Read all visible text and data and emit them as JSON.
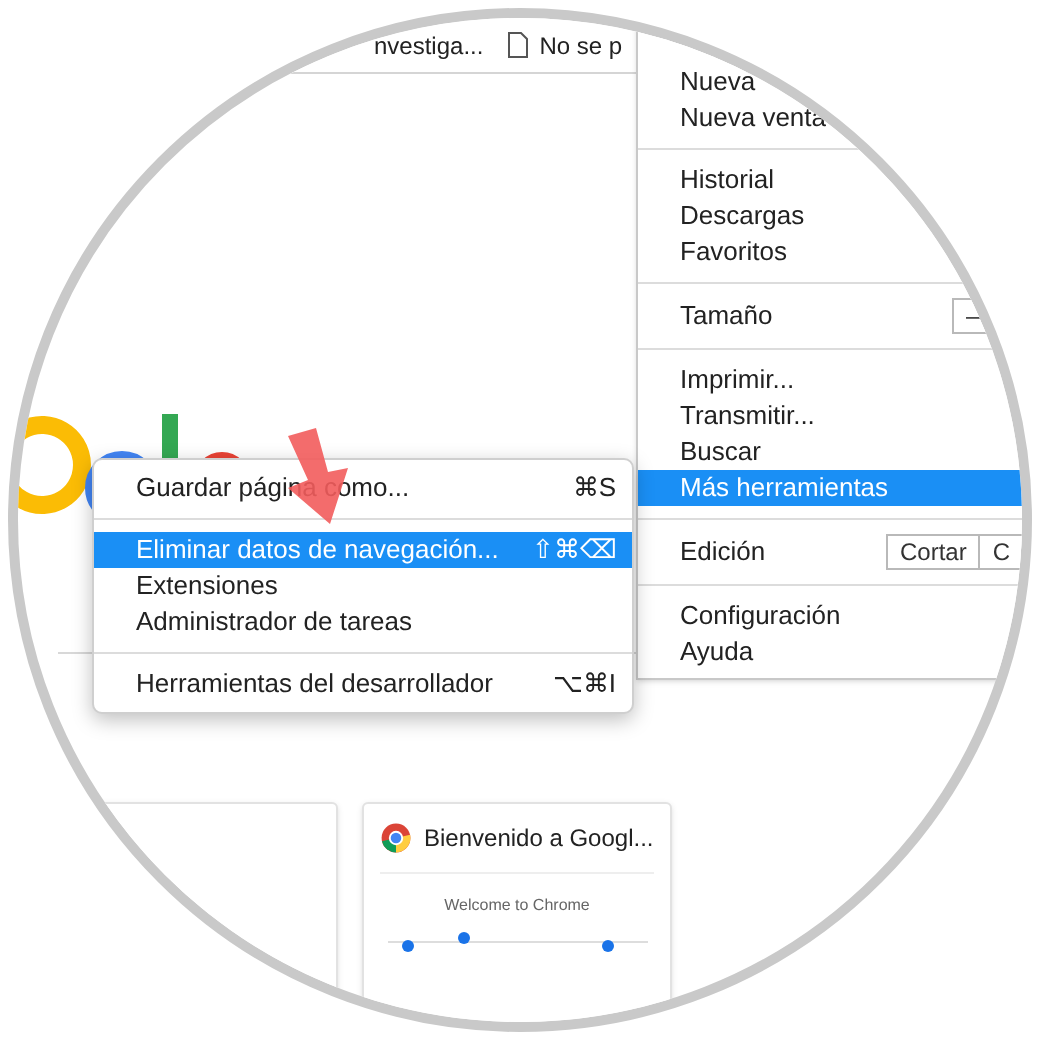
{
  "bookmarks": [
    {
      "label": "nvestiga...",
      "kind": "plain"
    },
    {
      "label": "No se p",
      "kind": "page"
    }
  ],
  "main_menu": [
    {
      "kind": "items",
      "items": [
        {
          "label": "Nueva",
          "selected": false
        },
        {
          "label": "Nueva venta",
          "selected": false
        }
      ]
    },
    {
      "kind": "items",
      "items": [
        {
          "label": "Historial",
          "selected": false
        },
        {
          "label": "Descargas",
          "selected": false
        },
        {
          "label": "Favoritos",
          "selected": false
        }
      ]
    },
    {
      "kind": "zoom",
      "label": "Tamaño",
      "buttons": [
        "—"
      ]
    },
    {
      "kind": "items",
      "items": [
        {
          "label": "Imprimir...",
          "selected": false
        },
        {
          "label": "Transmitir...",
          "selected": false
        },
        {
          "label": "Buscar",
          "selected": false
        },
        {
          "label": "Más herramientas",
          "selected": true
        }
      ]
    },
    {
      "kind": "edit",
      "label": "Edición",
      "buttons": [
        "Cortar",
        "C"
      ]
    },
    {
      "kind": "items",
      "items": [
        {
          "label": "Configuración",
          "selected": false
        },
        {
          "label": "Ayuda",
          "selected": false
        }
      ]
    }
  ],
  "submenu": [
    [
      {
        "label": "Guardar página como...",
        "shortcut": "⌘S",
        "selected": false
      }
    ],
    [
      {
        "label": "Eliminar datos de navegación...",
        "shortcut": "⇧⌘⌫",
        "selected": true
      },
      {
        "label": "Extensiones",
        "selected": false
      },
      {
        "label": "Administrador de tareas",
        "selected": false
      }
    ],
    [
      {
        "label": "Herramientas del desarrollador",
        "shortcut": "⌥⌘I",
        "selected": false
      }
    ]
  ],
  "tiles": [
    {
      "kind": "blank"
    },
    {
      "kind": "site",
      "title": "Bienvenido a Googl...",
      "preview_heading": "Welcome to Chrome"
    }
  ]
}
